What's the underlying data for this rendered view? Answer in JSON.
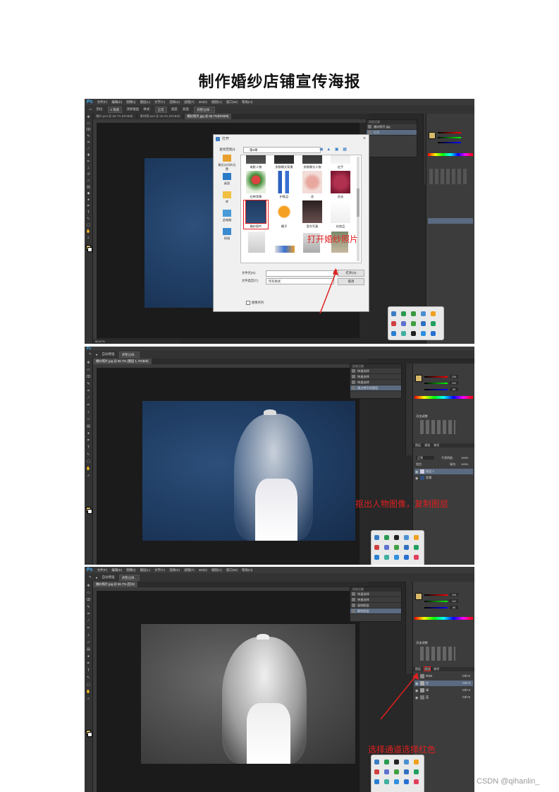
{
  "document": {
    "title": "制作婚纱店铺宣传海报",
    "watermark": "CSDN @qihanlin_"
  },
  "colors": {
    "annotation_red": "#e02020",
    "ps_dark": "#282828",
    "ps_panel": "#3c3c3c",
    "ps_logo_blue": "#3fa9f5"
  },
  "shot1": {
    "ps_logo": "Ps",
    "menu": [
      "文件(F)",
      "编辑(E)",
      "图像(I)",
      "图层(L)",
      "文字(Y)",
      "选择(S)",
      "滤镜(T)",
      "3D(D)",
      "视图(V)",
      "窗口(W)",
      "帮助(H)"
    ],
    "options": [
      "羽化:",
      "0 像素",
      "消除锯齿",
      "样式:",
      "正常",
      "宽度:",
      "高度:",
      "调整边缘..."
    ],
    "tabs": [
      "婚纱.psd @ 66.7% (RGB/8)",
      "素材图.psd @ 33.3% (RGB/8)",
      "婚纱照片.jpg @ 66.7%(RGB/8)"
    ],
    "history_panel": {
      "title": "历史记录",
      "rows": [
        "婚纱照片.jpg",
        "打开"
      ]
    },
    "dialog": {
      "title": "打开",
      "look_in_label": "查找范围(I):",
      "look_in_value": "第6章",
      "places": [
        "最近访问的位置",
        "桌面",
        "库",
        "此电脑",
        "网络"
      ],
      "files": [
        {
          "name": "电影人物",
          "icon": "photo-icon"
        },
        {
          "name": "多数模光背景",
          "icon": "photo-icon"
        },
        {
          "name": "多数模光人物",
          "icon": "photo-icon"
        },
        {
          "name": "红手",
          "icon": "photo-icon"
        },
        {
          "name": "红带背景",
          "icon": "photo-icon"
        },
        {
          "name": "护肤品",
          "icon": "photo-icon"
        },
        {
          "name": "花",
          "icon": "photo-icon"
        },
        {
          "name": "花朵",
          "icon": "photo-icon"
        },
        {
          "name": "婚纱照片",
          "icon": "photo-icon"
        },
        {
          "name": "橘子",
          "icon": "photo-icon"
        },
        {
          "name": "室内写真",
          "icon": "photo-icon"
        },
        {
          "name": "化妆品",
          "icon": "photo-icon"
        }
      ],
      "filename_label": "文件名(N):",
      "filetype_label": "文件类型(T):",
      "filetype_value": "所有格式",
      "open_button": "打开(O)",
      "cancel_button": "取消",
      "sequence_checkbox": "图像序列"
    },
    "annotation": "打开婚纱照片",
    "zoom": "66.67%"
  },
  "shot2": {
    "ps_logo": "Ps",
    "options": [
      "自动增强",
      "调整边缘..."
    ],
    "tab": "婚纱照片.jpg @ 66.7% (图层 1, RGB/8)",
    "history_panel": {
      "title": "历史记录",
      "rows": [
        "快速选择",
        "快速选择",
        "快速选择",
        "通过拷贝的图层"
      ]
    },
    "color_values": [
      "206",
      "162",
      "65"
    ],
    "adjust_title": "添加调整",
    "layers_tabs": [
      "图层",
      "通道",
      "路径"
    ],
    "blend_mode": "正常",
    "opacity_label": "不透明度:",
    "opacity_value": "100%",
    "fill_label": "填充:",
    "fill_value": "100%",
    "lock_label": "锁定:",
    "layers": [
      "图层 1",
      "背景"
    ],
    "annotation": "抠出人物图像，复制图层"
  },
  "shot3": {
    "ps_logo": "Ps",
    "menu": [
      "文件(F)",
      "编辑(E)",
      "图像(I)",
      "图层(L)",
      "文字(Y)",
      "选择(S)",
      "滤镜(T)",
      "3D(D)",
      "视图(V)",
      "窗口(W)",
      "帮助(H)"
    ],
    "options": [
      "自动增强",
      "调整边缘..."
    ],
    "tab": "婚纱照片.jpg @ 66.7% (红/8)",
    "history_panel": {
      "title": "历史记录",
      "rows": [
        "快速选择",
        "快速选择",
        "复制图层",
        "删除图层"
      ]
    },
    "color_values": [
      "206",
      "162",
      "65"
    ],
    "adjust_title": "添加调整",
    "channel_tabs": [
      "图层",
      "通道",
      "路径"
    ],
    "channels": [
      {
        "name": "RGB",
        "shortcut": "Ctrl+2"
      },
      {
        "name": "红",
        "shortcut": "Ctrl+3"
      },
      {
        "name": "绿",
        "shortcut": "Ctrl+4"
      },
      {
        "name": "蓝",
        "shortcut": "Ctrl+5"
      }
    ],
    "annotation": "选择通道选择红色"
  }
}
